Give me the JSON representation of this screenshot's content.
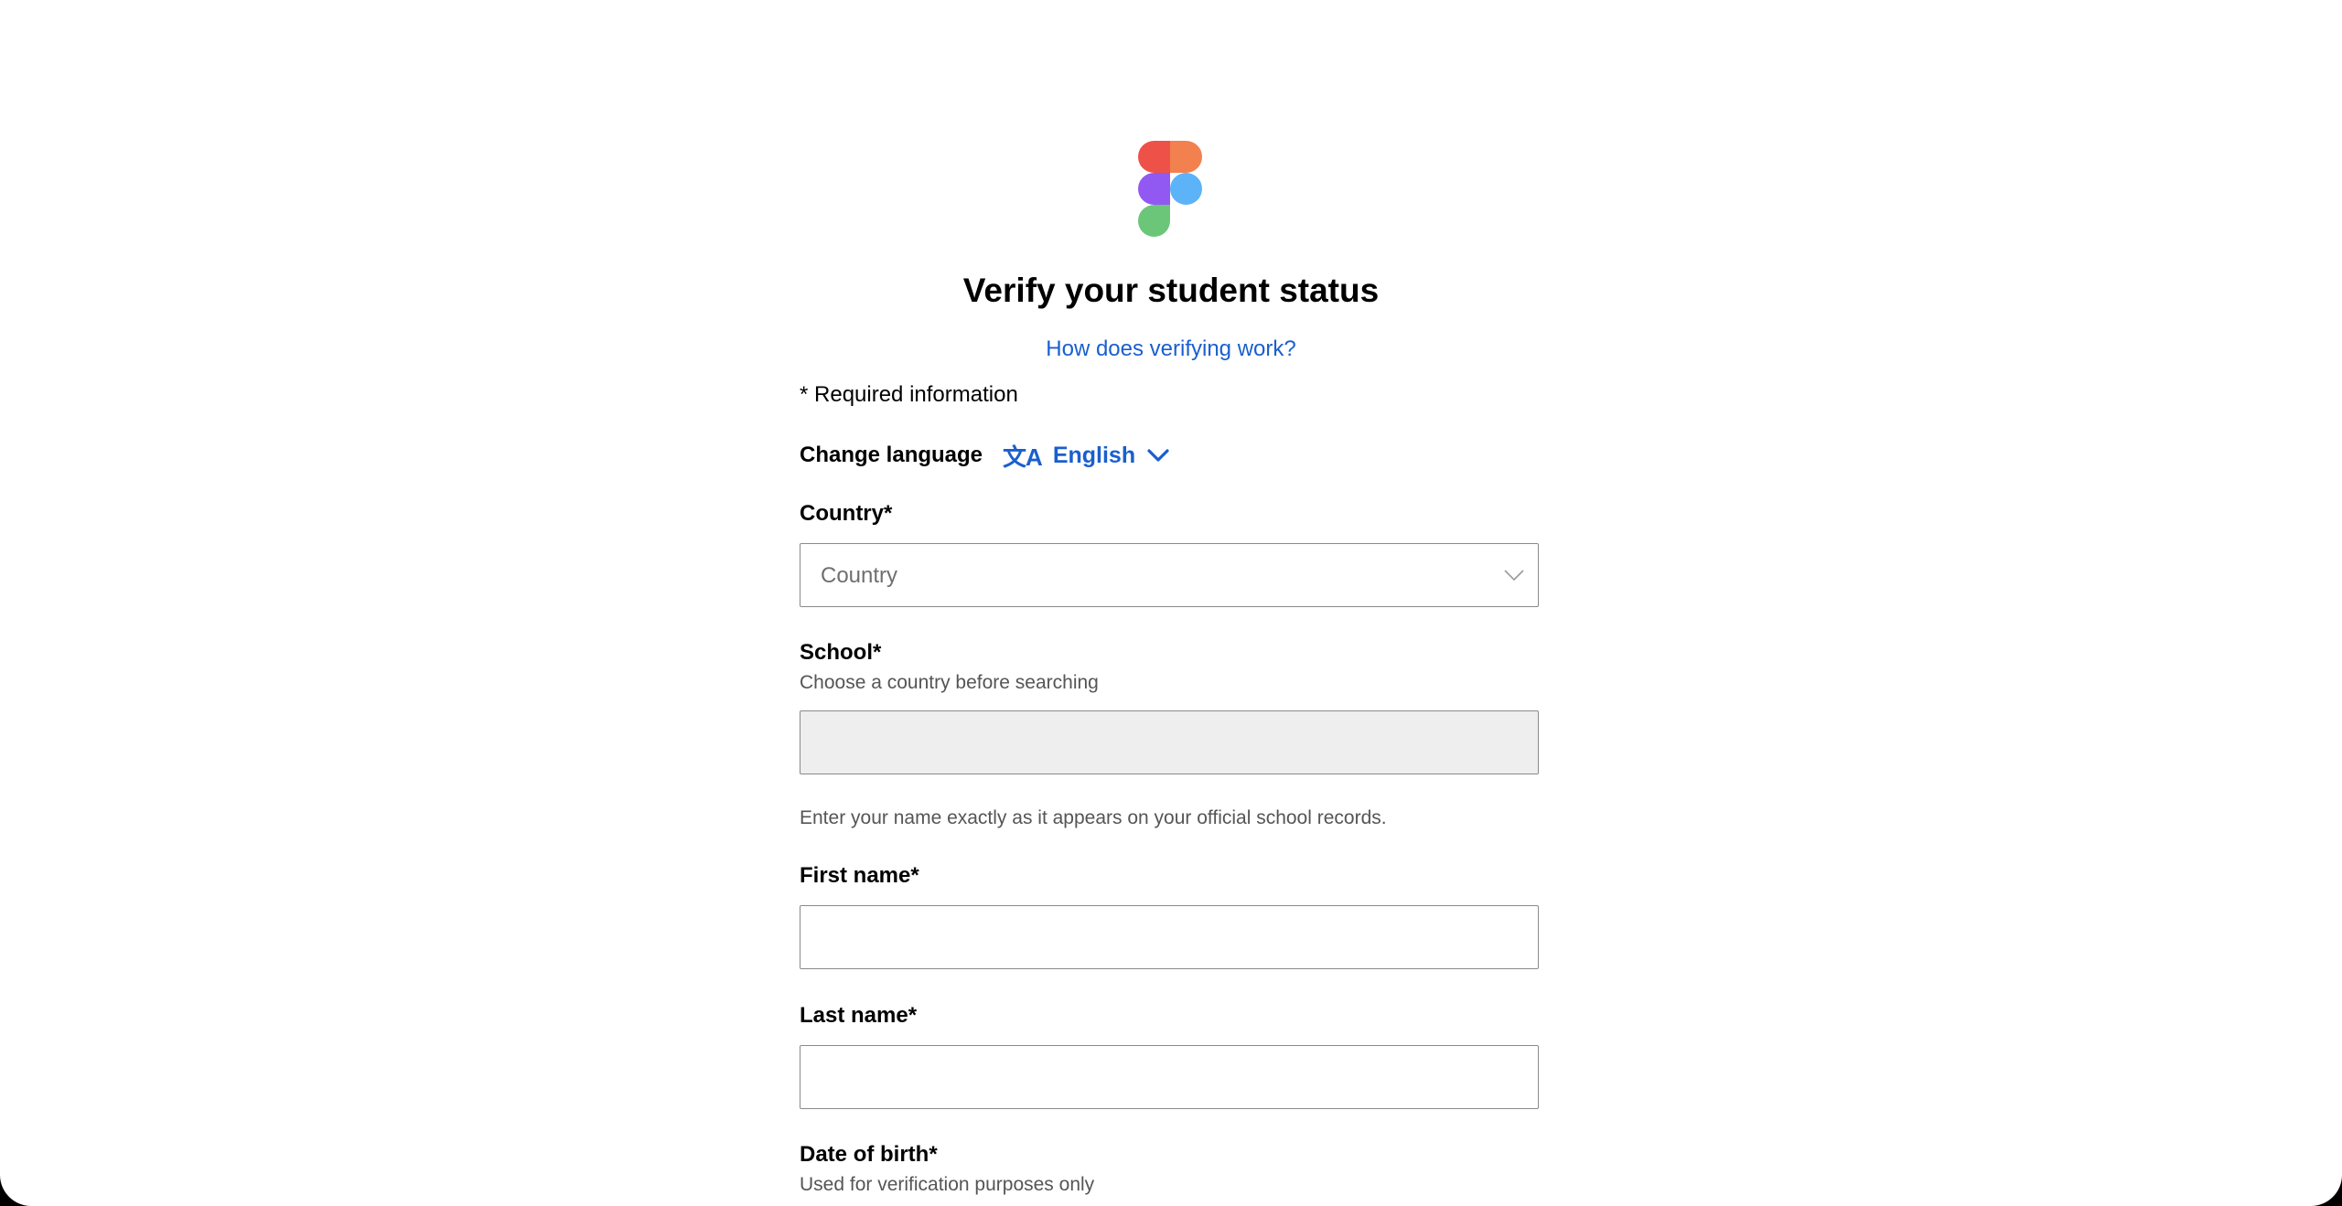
{
  "page": {
    "title": "Verify your student status",
    "help_link": "How does verifying work?",
    "required_info": "* Required information"
  },
  "language": {
    "label": "Change language",
    "icon_glyph": "文A",
    "icon": "translate-icon",
    "selected": "English"
  },
  "fields": {
    "country": {
      "label": "Country*",
      "placeholder": "Country",
      "value": ""
    },
    "school": {
      "label": "School*",
      "hint": "Choose a country before searching",
      "value": ""
    },
    "name_hint": "Enter your name exactly as it appears on your official school records.",
    "first_name": {
      "label": "First name*",
      "value": ""
    },
    "last_name": {
      "label": "Last name*",
      "value": ""
    },
    "date_of_birth": {
      "label": "Date of birth*",
      "hint": "Used for verification purposes only"
    }
  },
  "colors": {
    "link": "#1a5fce",
    "logo_red": "#f24e1e",
    "logo_orange": "#ff7262",
    "logo_purple": "#a259ff",
    "logo_blue": "#1abcfe",
    "logo_green": "#0acf83"
  }
}
